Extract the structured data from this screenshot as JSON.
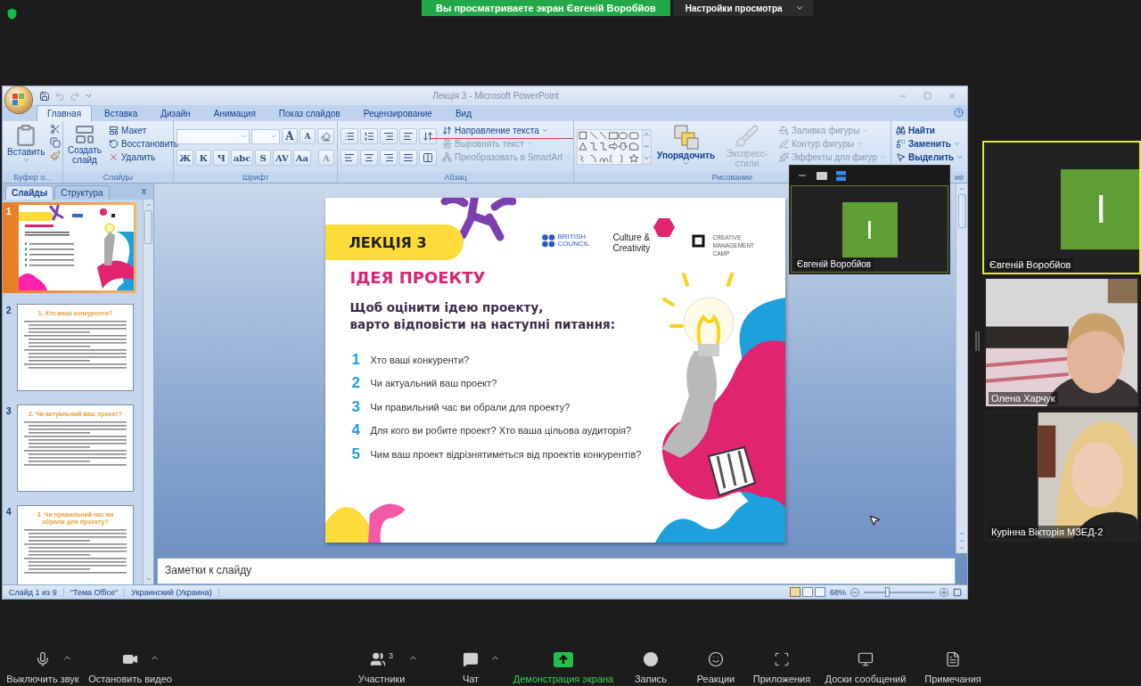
{
  "top_bar": {
    "banner": "Вы просматриваете экран Євгеній Воробйов",
    "view_options": "Настройки просмотра"
  },
  "powerpoint": {
    "title": "Лекція 3 - Microsoft PowerPoint",
    "tabs": [
      {
        "label": "Главная",
        "selected": true
      },
      {
        "label": "Вставка",
        "selected": false
      },
      {
        "label": "Дизайн",
        "selected": false
      },
      {
        "label": "Анимация",
        "selected": false
      },
      {
        "label": "Показ слайдов",
        "selected": false
      },
      {
        "label": "Рецензирование",
        "selected": false
      },
      {
        "label": "Вид",
        "selected": false
      }
    ],
    "ribbon": {
      "clipboard": {
        "paste": "Вставить",
        "group": "Буфер о..."
      },
      "slides": {
        "new_slide": "Создать слайд",
        "items": [
          "Макет",
          "Восстановить",
          "Удалить"
        ],
        "group": "Слайды"
      },
      "font": {
        "size_buttons": [
          "A",
          "A"
        ],
        "format_buttons": [
          "Ж",
          "К",
          "Ч",
          "abc",
          "S",
          "AV",
          "Aa"
        ],
        "color_button": "A",
        "group": "Шрифт"
      },
      "paragraph": {
        "items": [
          {
            "label": "Направление текста",
            "disabled": false
          },
          {
            "label": "Выровнять текст",
            "disabled": true
          },
          {
            "label": "Преобразовать в SmartArt",
            "disabled": true
          }
        ],
        "group": "Абзац"
      },
      "drawing": {
        "arrange": "Упорядочить",
        "styles": "Экспресс-стили",
        "items": [
          {
            "label": "Заливка фигуры",
            "disabled": true
          },
          {
            "label": "Контур фигуры",
            "disabled": true
          },
          {
            "label": "Эффекты для фигур",
            "disabled": true
          }
        ],
        "group": "Рисование"
      },
      "editing": {
        "items": [
          "Найти",
          "Заменить",
          "Выделить"
        ],
        "group": "ие"
      }
    },
    "pane_tabs": [
      {
        "label": "Слайды",
        "selected": true
      },
      {
        "label": "Структура",
        "selected": false
      }
    ],
    "pane_close": "x",
    "thumbnails": [
      {
        "number": "1",
        "kind": "cover",
        "selected": true
      },
      {
        "number": "2",
        "kind": "text",
        "title": "1. Хто ваші конкуренти?",
        "selected": false
      },
      {
        "number": "3",
        "kind": "text",
        "title": "2. Чи актуальний ваш проект?",
        "selected": false
      },
      {
        "number": "4",
        "kind": "text",
        "title": "3. Чи правильний час ви обрали для проекту?",
        "selected": false
      }
    ],
    "slide": {
      "badge": "ЛЕКЦІЯ 3",
      "british_council": [
        "BRITISH",
        "COUNCIL"
      ],
      "culture": [
        "Culture &",
        "Creativity"
      ],
      "camp": [
        "CREATIVE",
        "MANAGEMENT",
        "CAMP"
      ],
      "heading": "ІДЕЯ ПРОЕКТУ",
      "intro": [
        "Щоб оцінити ідею проекту,",
        "варто відповісти на наступні питання:"
      ],
      "questions": [
        {
          "number": "1",
          "text": "Хто ваші конкуренти?"
        },
        {
          "number": "2",
          "text": "Чи актуальний ваш проект?"
        },
        {
          "number": "3",
          "text": "Чи правильний час ви обрали для проекту?"
        },
        {
          "number": "4",
          "text": "Для кого ви робите проект? Хто ваша цільова аудиторія?"
        },
        {
          "number": "5",
          "text": "Чим ваш проект відрізнятиметься від проектів конкурентів?"
        }
      ]
    },
    "notes_placeholder": "Заметки к слайду",
    "status": [
      "Слайд 1 из 9",
      "\"Тема Office\"",
      "Украинский (Украина)"
    ],
    "zoom": {
      "reading": "68%",
      "level": 0.32
    }
  },
  "self_view": {
    "name": "Євгеній Воробйов",
    "avatar": "I"
  },
  "gallery": [
    {
      "name": "Євгеній Воробйов",
      "kind": "avatar",
      "avatar": "I",
      "speaking": true
    },
    {
      "name": "Олена Харчук",
      "kind": "video",
      "speaking": false
    },
    {
      "name": "Курінна Вікторія МЗЕД-2",
      "kind": "video",
      "speaking": false
    }
  ],
  "toolbar": [
    {
      "label": "Выключить звук",
      "kind": "mic",
      "caret": true,
      "active": false
    },
    {
      "label": "Остановить видео",
      "kind": "video",
      "caret": true,
      "active": false
    },
    {
      "label": "Участники",
      "kind": "participants",
      "count": "3",
      "caret": true,
      "active": false
    },
    {
      "label": "Чат",
      "kind": "chat",
      "caret": true,
      "active": false
    },
    {
      "label": "Демонстрация экрана",
      "kind": "share",
      "caret": false,
      "active": true
    },
    {
      "label": "Запись",
      "kind": "record",
      "caret": false,
      "active": false
    },
    {
      "label": "Реакции",
      "kind": "reactions",
      "caret": false,
      "active": false
    },
    {
      "label": "Приложения",
      "kind": "apps",
      "caret": false,
      "active": false
    },
    {
      "label": "Доски сообщений",
      "kind": "whiteboard",
      "caret": false,
      "active": false
    },
    {
      "label": "Примечания",
      "kind": "notes",
      "caret": false,
      "active": false
    }
  ]
}
